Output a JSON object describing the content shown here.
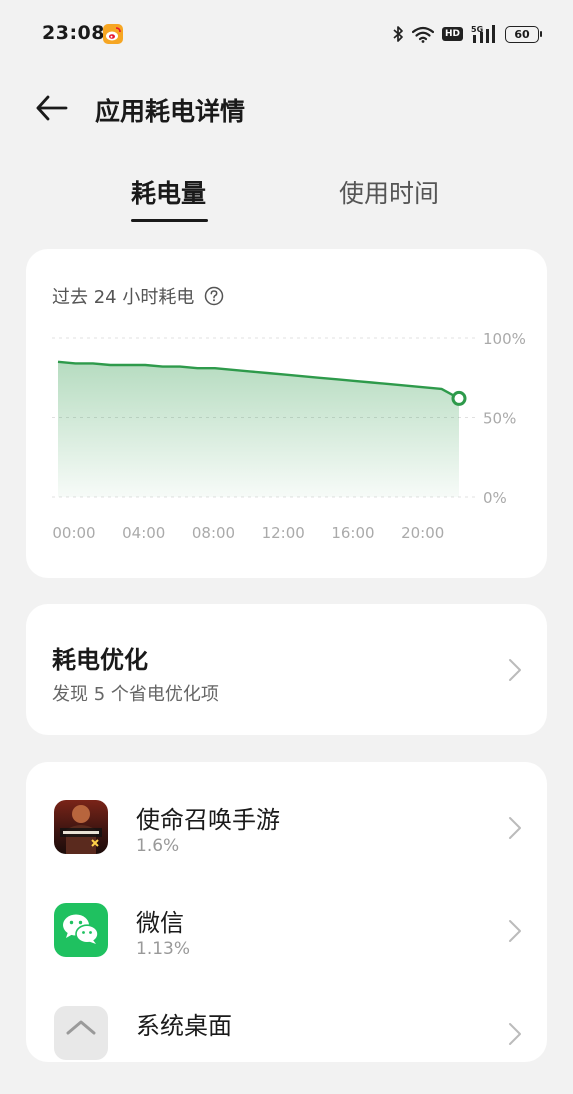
{
  "status_bar": {
    "time": "23:08",
    "battery_level": "60",
    "network": "5G",
    "hd_label": "HD",
    "notification_icon": "weibo-icon"
  },
  "header": {
    "title": "应用耗电详情",
    "back_icon": "back-arrow-icon"
  },
  "tabs": [
    {
      "label": "耗电量",
      "active": true
    },
    {
      "label": "使用时间",
      "active": false
    }
  ],
  "chart_card": {
    "heading": "过去 24 小时耗电",
    "help_icon": "help-icon"
  },
  "chart_data": {
    "type": "area",
    "x": [
      "00:00",
      "01:00",
      "02:00",
      "03:00",
      "04:00",
      "05:00",
      "06:00",
      "07:00",
      "08:00",
      "09:00",
      "10:00",
      "11:00",
      "12:00",
      "13:00",
      "14:00",
      "15:00",
      "16:00",
      "17:00",
      "18:00",
      "19:00",
      "20:00",
      "21:00",
      "22:00",
      "23:00"
    ],
    "values": [
      85,
      84,
      84,
      83,
      83,
      83,
      82,
      82,
      81,
      81,
      80,
      79,
      78,
      77,
      76,
      75,
      74,
      73,
      72,
      71,
      70,
      69,
      68,
      62
    ],
    "xtick_labels": [
      "00:00",
      "04:00",
      "08:00",
      "12:00",
      "16:00",
      "20:00"
    ],
    "ytick_labels": [
      "100%",
      "50%",
      "0%"
    ],
    "ylim": [
      0,
      100
    ],
    "grid": true,
    "color": "#2e9a4b"
  },
  "optimization": {
    "title": "耗电优化",
    "subtitle": "发现 5 个省电优化项"
  },
  "apps": [
    {
      "name": "使命召唤手游",
      "percent": "1.6%",
      "icon": "call-of-duty-icon"
    },
    {
      "name": "微信",
      "percent": "1.13%",
      "icon": "wechat-icon"
    },
    {
      "name": "系统桌面",
      "percent": "",
      "icon": "launcher-icon"
    }
  ]
}
